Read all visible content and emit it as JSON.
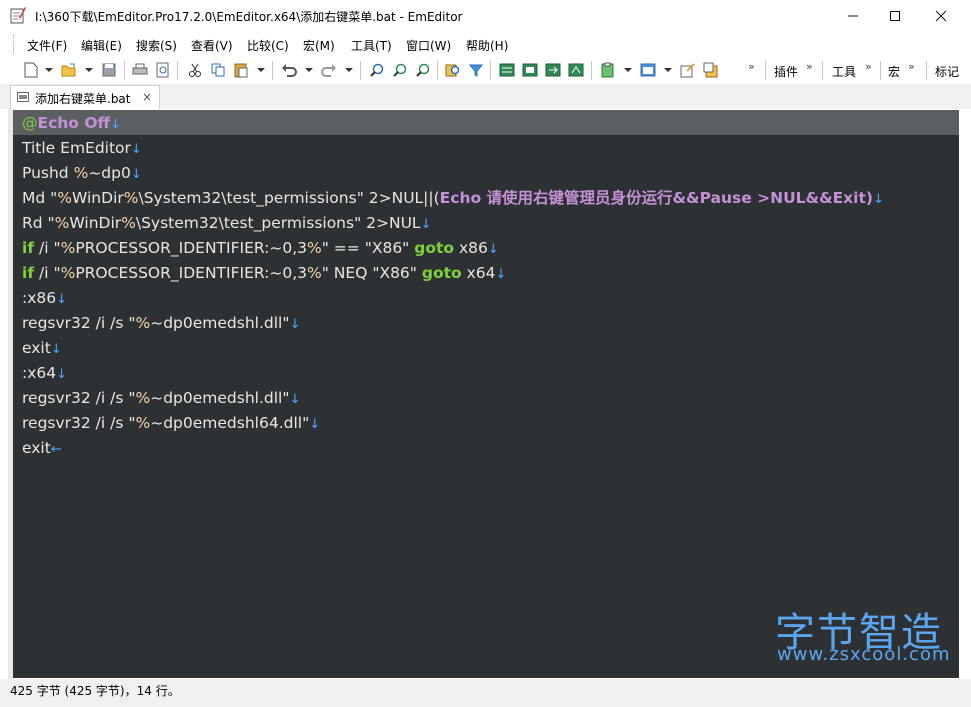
{
  "window": {
    "title": "I:\\360下载\\EmEditor.Pro17.2.0\\EmEditor.x64\\添加右键菜单.bat - EmEditor",
    "minimize_icon": "minimize-icon",
    "maximize_icon": "maximize-icon",
    "close_icon": "close-icon"
  },
  "menu": [
    {
      "label": "文件(F)"
    },
    {
      "label": "编辑(E)"
    },
    {
      "label": "搜索(S)"
    },
    {
      "label": "查看(V)"
    },
    {
      "label": "比较(C)"
    },
    {
      "label": "宏(M)"
    },
    {
      "label": "工具(T)"
    },
    {
      "label": "窗口(W)"
    },
    {
      "label": "帮助(H)"
    }
  ],
  "toolbar": {
    "plugins_label": "插件",
    "tools_label": "工具",
    "macro_label": "宏",
    "mark_label": "标记",
    "icons": [
      "new-file-icon",
      "open-folder-icon",
      "save-icon",
      "print-icon",
      "print-preview-icon",
      "cut-icon",
      "copy-icon",
      "paste-icon",
      "undo-icon",
      "redo-icon",
      "find-icon",
      "find-next-icon",
      "find-previous-icon",
      "find-in-files-icon",
      "filter-icon",
      "outline-icon",
      "split-icon",
      "sync-scroll-icon",
      "compare-icon",
      "clipboard-icon",
      "window-icon",
      "customize-icon",
      "properties-icon"
    ]
  },
  "tab": {
    "label": "添加右键菜单.bat",
    "close": "×"
  },
  "editor": {
    "lines": [
      [
        "@",
        "Echo Off"
      ],
      [
        "Title EmEditor"
      ],
      [
        "Pushd ",
        "%",
        "~dp0"
      ],
      [
        "Md \"",
        "%",
        "WinDir",
        "%",
        "\\System32\\test_permissions\" 2>NUL||(",
        "Echo 请使用右键管理员身份运行&&Pause >NUL&&Exit)"
      ],
      [
        "Rd \"",
        "%",
        "WinDir",
        "%",
        "\\System32\\test_permissions\" 2>NUL"
      ],
      [
        "if",
        " /i \"",
        "%",
        "PROCESSOR_IDENTIFIER:~0,3",
        "%",
        "\" == \"X86\" ",
        "goto",
        " x86"
      ],
      [
        "if",
        " /i \"",
        "%",
        "PROCESSOR_IDENTIFIER:~0,3",
        "%",
        "\" NEQ \"X86\" ",
        "goto",
        " x64"
      ],
      [
        ":x86"
      ],
      [
        "regsvr32 /i /s \"",
        "%",
        "~dp0emedshl.dll\""
      ],
      [
        "exit"
      ],
      [
        ":x64"
      ],
      [
        "regsvr32 /i /s \"",
        "%",
        "~dp0emedshl.dll\""
      ],
      [
        "regsvr32 /i /s \"",
        "%",
        "~dp0emedshl64.dll\""
      ],
      [
        "exit"
      ]
    ],
    "newline_mark": "↓",
    "eof_mark": "←"
  },
  "status": {
    "text": "425 字节 (425 字节)，14 行。"
  },
  "watermark": {
    "logo": "字节智造",
    "url": "www.zsxcool.com"
  },
  "colors": {
    "editor_bg": "#2e3133",
    "current_line": "#5b5f62",
    "keyword": "#7fd03a",
    "echo": "#c391d6",
    "percent": "#f4d7a8",
    "newline": "#4ea6ff"
  }
}
